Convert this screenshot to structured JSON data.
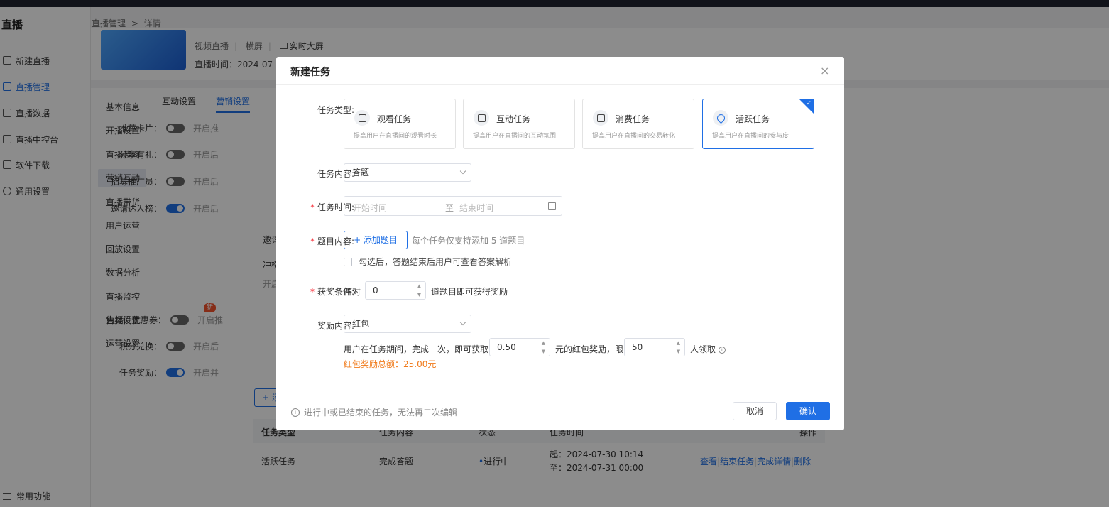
{
  "sidebar": {
    "brand": "直播",
    "items": [
      {
        "label": "新建直播"
      },
      {
        "label": "直播管理"
      },
      {
        "label": "直播数据"
      },
      {
        "label": "直播中控台"
      },
      {
        "label": "软件下载"
      },
      {
        "label": "通用设置"
      }
    ],
    "bottom": "常用功能"
  },
  "breadcrumb": {
    "parent": "直播管理",
    "sep": ">",
    "current": "详情"
  },
  "live": {
    "type": "视频直播",
    "orientation": "横屏",
    "screen": "实时大屏",
    "time": "直播时间：2024-07-3"
  },
  "subnav": [
    "基本信息",
    "开播设置",
    "直播装修",
    "营销互动",
    "直播带货",
    "用户运营",
    "回放设置",
    "数据分析",
    "直播监控",
    "售卖设置",
    "运营设置"
  ],
  "tabs": [
    "互动设置",
    "营销设置"
  ],
  "settings": [
    {
      "label": "推荐卡片：",
      "desc": "开启推"
    },
    {
      "label": "分享有礼：",
      "desc": "开启后"
    },
    {
      "label": "招募推广员：",
      "desc": "开启后"
    },
    {
      "label": "邀请达人榜：",
      "desc": "开启后"
    },
    {
      "label": "直播间优惠券：",
      "desc": "开启推"
    },
    {
      "label": "积分兑换：",
      "desc": "开启后"
    },
    {
      "label": "任务奖励：",
      "desc": "开启并"
    }
  ],
  "bg_fragments": {
    "a": "邀请",
    "b": "冲榜",
    "c": "开启",
    "new": "新",
    "add": "+ 添"
  },
  "task_table": {
    "headers": [
      "任务类型",
      "任务内容",
      "状态",
      "任务时间",
      "操作"
    ],
    "row": {
      "type": "活跃任务",
      "content": "完成答题",
      "status": "进行中",
      "start": "起：2024-07-30 10:14",
      "end": "至：2024-07-31 00:00",
      "actions": [
        "查看",
        "结束任务",
        "完成详情",
        "删除"
      ]
    }
  },
  "modal": {
    "title": "新建任务",
    "close": "×",
    "task_type_label": "任务类型:",
    "task_types": [
      {
        "name": "观看任务",
        "desc": "提高用户在直播间的观看时长"
      },
      {
        "name": "互动任务",
        "desc": "提高用户在直播间的互动氛围"
      },
      {
        "name": "消费任务",
        "desc": "提高用户在直播间的交易转化"
      },
      {
        "name": "活跃任务",
        "desc": "提高用户在直播间的参与度"
      }
    ],
    "content_label": "任务内容:",
    "content_value": "答题",
    "time_label": "任务时间:",
    "time_start_placeholder": "开始时间",
    "time_sep": "至",
    "time_end_placeholder": "结束时间",
    "question_label": "题目内容:",
    "add_question": "+ 添加题目",
    "question_hint": "每个任务仅支持添加 5 道题目",
    "checkbox_text": "勾选后，答题结束后用户可查看答案解析",
    "award_cond_label": "获奖条件:",
    "award_cond_prefix": "答对",
    "award_cond_value": "0",
    "award_cond_suffix": "道题目即可获得奖励",
    "reward_label": "奖励内容:",
    "reward_value": "红包",
    "reward_text1": "用户在任务期间，完成一次，即可获取",
    "reward_amount": "0.50",
    "reward_text2": "元的红包奖励，限",
    "reward_limit": "50",
    "reward_text3": "人领取",
    "reward_total": "红包奖励总额：25.00元",
    "footer_note": "进行中或已结束的任务，无法再二次编辑",
    "cancel": "取消",
    "confirm": "确认"
  },
  "colors": {
    "accent": "#1f6fe5",
    "danger": "#f5222d",
    "warning": "#f07a1a"
  }
}
